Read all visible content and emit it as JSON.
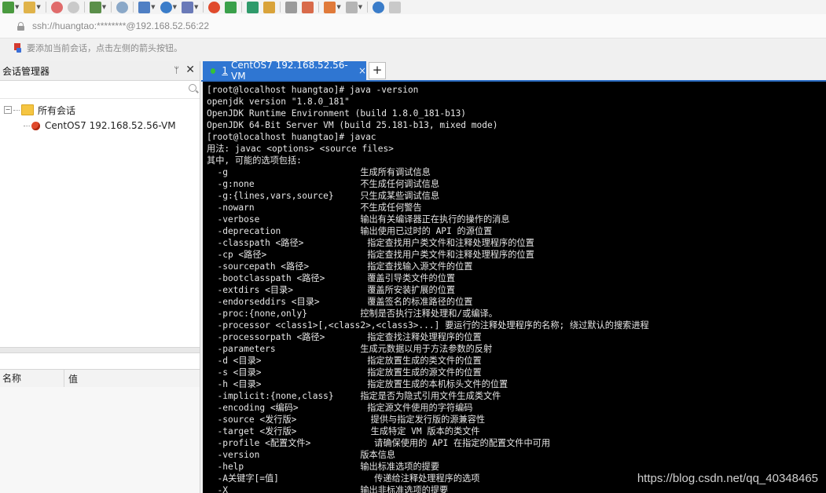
{
  "toolbar": {
    "icons": [
      "new-session-icon",
      "open-folder-icon",
      "disconnect-icon",
      "reconnect-icon",
      "properties-icon",
      "find-icon",
      "layout-icon",
      "globe-icon",
      "font-icon",
      "xshell-icon",
      "xftp-icon",
      "fullscreen-icon",
      "lock-icon",
      "keyboard-icon",
      "highlight-icon",
      "add-icon",
      "window-icon",
      "help-icon",
      "chat-icon"
    ]
  },
  "address_bar": {
    "text": "ssh://huangtao:********@192.168.52.56:22"
  },
  "hint_bar": {
    "text": "要添加当前会话，点击左侧的箭头按钮。"
  },
  "session_manager": {
    "title": "会话管理器",
    "pin": "ᛘ",
    "close": "✕",
    "tree": {
      "expander": "−",
      "root": "所有会话",
      "child": "CentOS7 192.168.52.56-VM"
    },
    "props": {
      "col_name": "名称",
      "col_value": "值"
    }
  },
  "tab": {
    "number": "1",
    "title": "CentOS7 192.168.52.56-VM",
    "close": "×",
    "add": "+"
  },
  "terminal": {
    "lines": [
      "[root@localhost huangtao]# java -version",
      "openjdk version \"1.8.0_181\"",
      "OpenJDK Runtime Environment (build 1.8.0_181-b13)",
      "OpenJDK 64-Bit Server VM (build 25.181-b13, mixed mode)",
      "[root@localhost huangtao]# javac",
      "用法: javac <options> <source files>",
      "其中, 可能的选项包括:",
      "  -g                         生成所有调试信息",
      "  -g:none                    不生成任何调试信息",
      "  -g:{lines,vars,source}     只生成某些调试信息",
      "  -nowarn                    不生成任何警告",
      "  -verbose                   输出有关编译器正在执行的操作的消息",
      "  -deprecation               输出使用已过时的 API 的源位置",
      "  -classpath <路径>            指定查找用户类文件和注释处理程序的位置",
      "  -cp <路径>                   指定查找用户类文件和注释处理程序的位置",
      "  -sourcepath <路径>           指定查找输入源文件的位置",
      "  -bootclasspath <路径>        覆盖引导类文件的位置",
      "  -extdirs <目录>              覆盖所安装扩展的位置",
      "  -endorseddirs <目录>         覆盖签名的标准路径的位置",
      "  -proc:{none,only}          控制是否执行注释处理和/或编译。",
      "  -processor <class1>[,<class2>,<class3>...] 要运行的注释处理程序的名称; 绕过默认的搜索进程",
      "  -processorpath <路径>        指定查找注释处理程序的位置",
      "  -parameters                生成元数据以用于方法参数的反射",
      "  -d <目录>                    指定放置生成的类文件的位置",
      "  -s <目录>                    指定放置生成的源文件的位置",
      "  -h <目录>                    指定放置生成的本机标头文件的位置",
      "  -implicit:{none,class}     指定是否为隐式引用文件生成类文件",
      "  -encoding <编码>             指定源文件使用的字符编码",
      "  -source <发行版>              提供与指定发行版的源兼容性",
      "  -target <发行版>              生成特定 VM 版本的类文件",
      "  -profile <配置文件>            请确保使用的 API 在指定的配置文件中可用",
      "  -version                   版本信息",
      "  -help                      输出标准选项的提要",
      "  -A关键字[=值]                  传递给注释处理程序的选项",
      "  -X                         输出非标准选项的提要"
    ]
  },
  "watermark": "https://blog.csdn.net/qq_40348465",
  "colors": {
    "tab_active": "#2f76d2",
    "terminal_bg": "#000000",
    "terminal_fg": "#e6e6e6",
    "status_dot": "#35c236"
  }
}
